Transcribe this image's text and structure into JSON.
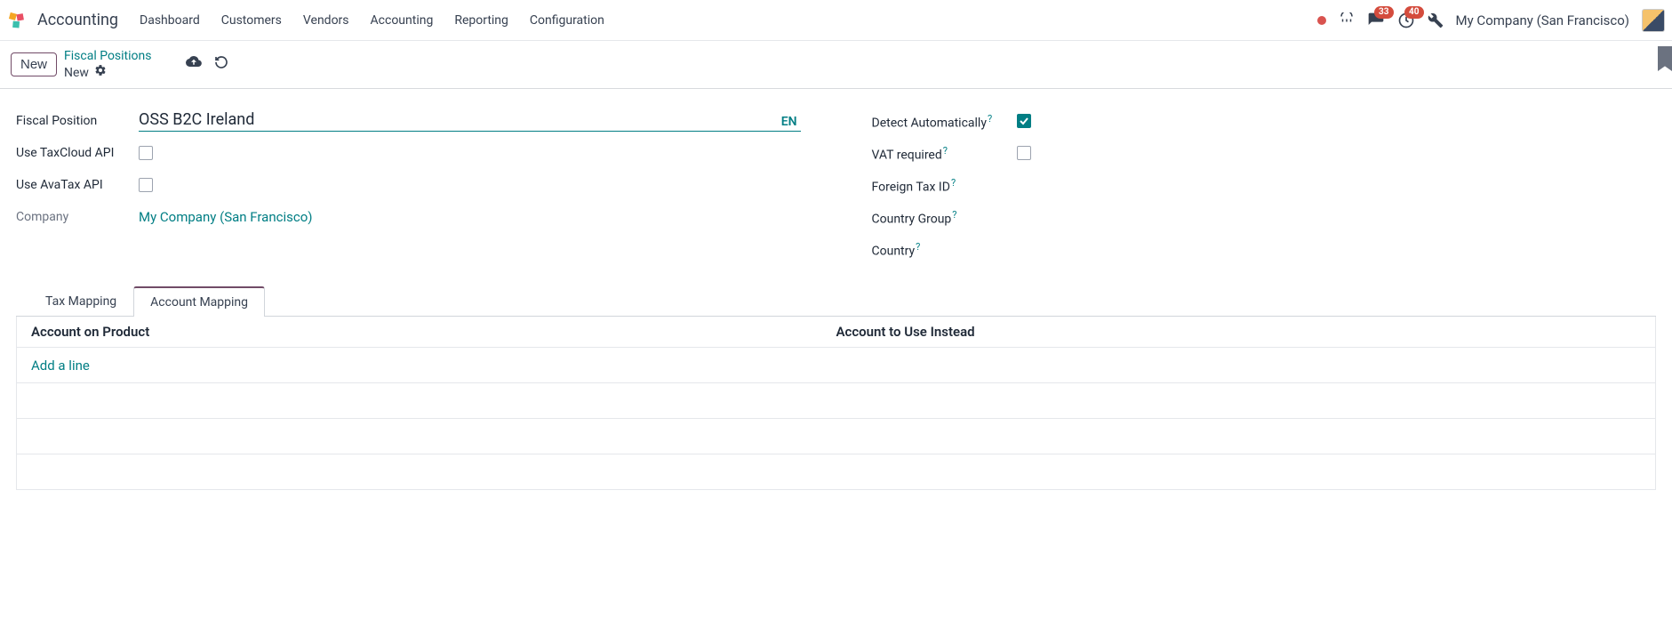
{
  "navbar": {
    "app": "Accounting",
    "menu": [
      "Dashboard",
      "Customers",
      "Vendors",
      "Accounting",
      "Reporting",
      "Configuration"
    ],
    "messages_badge": "33",
    "activity_badge": "40",
    "company": "My Company (San Francisco)"
  },
  "control": {
    "new_label": "New",
    "breadcrumb_link": "Fiscal Positions",
    "breadcrumb_current": "New"
  },
  "form": {
    "left": {
      "fiscal_position_label": "Fiscal Position",
      "fiscal_position_value": "OSS B2C Ireland",
      "lang": "EN",
      "use_taxcloud_label": "Use TaxCloud API",
      "use_taxcloud_checked": false,
      "use_avatax_label": "Use AvaTax API",
      "use_avatax_checked": false,
      "company_label": "Company",
      "company_value": "My Company (San Francisco)"
    },
    "right": {
      "detect_label": "Detect Automatically",
      "detect_checked": true,
      "vat_required_label": "VAT required",
      "vat_required_checked": false,
      "foreign_tax_label": "Foreign Tax ID",
      "country_group_label": "Country Group",
      "country_label": "Country"
    }
  },
  "tabs": {
    "tax_mapping": "Tax Mapping",
    "account_mapping": "Account Mapping"
  },
  "table": {
    "col1": "Account on Product",
    "col2": "Account to Use Instead",
    "add_line": "Add a line"
  }
}
